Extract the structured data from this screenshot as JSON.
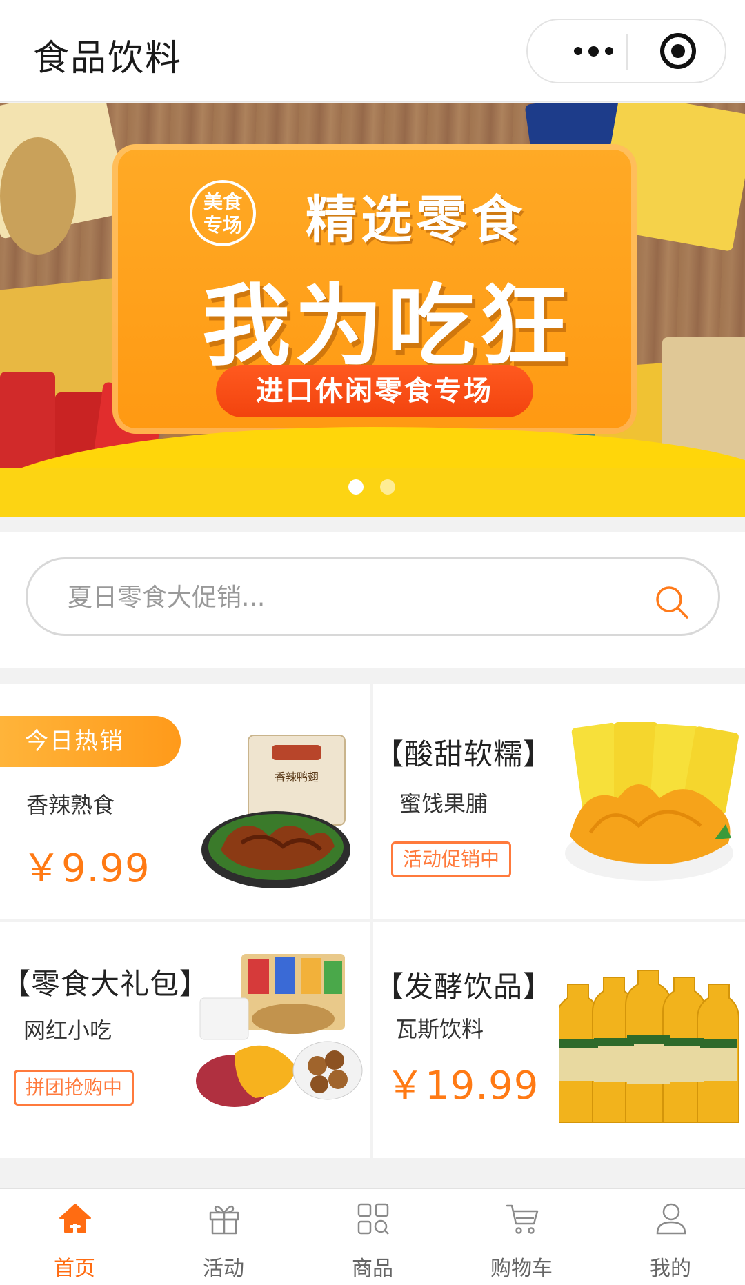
{
  "header": {
    "title": "食品饮料"
  },
  "banner": {
    "seal_line1": "美食",
    "seal_line2": "专场",
    "headline": "精选零食",
    "slogan": "我为吃狂",
    "pill": "进口休闲零食专场",
    "slide_count": 2,
    "active_slide": 1
  },
  "search": {
    "placeholder": "夏日零食大促销..."
  },
  "products": [
    {
      "tag": "今日热销",
      "subtitle": "香辣熟食",
      "price": "￥9.99"
    },
    {
      "title": "【酸甜软糯】",
      "subtitle": "蜜饯果脯",
      "badge": "活动促销中"
    },
    {
      "title": "【零食大礼包】",
      "subtitle": "网红小吃",
      "badge": "拼团抢购中"
    },
    {
      "title": "【发酵饮品】",
      "subtitle": "瓦斯饮料",
      "price": "￥19.99"
    }
  ],
  "tabbar": [
    {
      "label": "首页",
      "icon": "home-icon",
      "active": true
    },
    {
      "label": "活动",
      "icon": "gift-icon",
      "active": false
    },
    {
      "label": "商品",
      "icon": "grid-icon",
      "active": false
    },
    {
      "label": "购物车",
      "icon": "cart-icon",
      "active": false
    },
    {
      "label": "我的",
      "icon": "user-icon",
      "active": false
    }
  ],
  "colors": {
    "accent": "#ff6c12",
    "price": "#ff7a14",
    "tag": "#ffa726"
  }
}
